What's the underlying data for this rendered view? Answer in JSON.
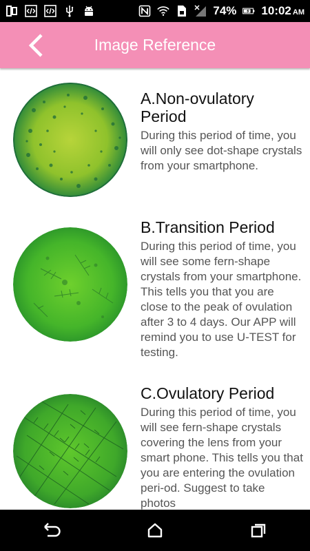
{
  "status_bar": {
    "battery_percent": "74%",
    "time": "10:02",
    "ampm": "AM",
    "icons_left": [
      "tablet-icon",
      "code-icon",
      "code-icon",
      "usb-icon",
      "android-icon"
    ],
    "icons_right": [
      "nfc-icon",
      "wifi-icon",
      "sim-icon",
      "signal-icon",
      "battery-icon"
    ]
  },
  "header": {
    "title": "Image Reference",
    "back_icon": "chevron-left-icon",
    "background": "#f48fb6"
  },
  "entries": [
    {
      "title": "A.Non-ovulatory Period",
      "description": "During this period of time, you will only see dot-shape crystals from your smartphone."
    },
    {
      "title": "B.Transition Period",
      "description": "During this period of time, you will see some fern-shape crystals from your smartphone. This tells you that you are close to the peak of ovulation after 3 to 4 days. Our APP will remind you to use U-TEST for testing."
    },
    {
      "title": "C.Ovulatory Period",
      "description": "During this period of time, you will see fern-shape crystals covering the lens from your smart phone. This tells you that you are entering the ovulation peri-od. Suggest to take photos"
    }
  ],
  "nav": {
    "back_icon": "back-icon",
    "home_icon": "home-icon",
    "recents_icon": "recents-icon"
  }
}
